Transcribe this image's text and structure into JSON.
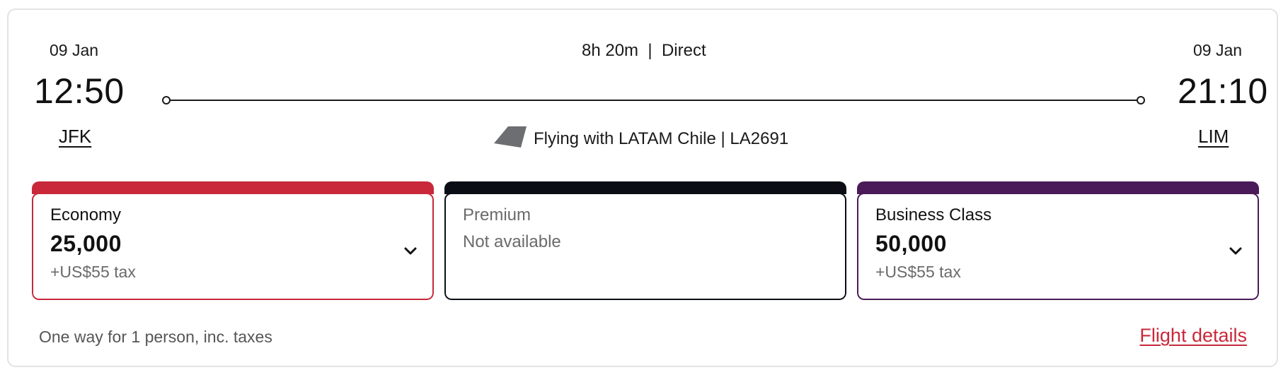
{
  "departure": {
    "date": "09 Jan",
    "time": "12:50",
    "airport": "JFK"
  },
  "arrival": {
    "date": "09 Jan",
    "time": "21:10",
    "airport": "LIM"
  },
  "duration_text": "8h 20m  |  Direct",
  "airline": {
    "text": "Flying with LATAM Chile | LA2691",
    "icon": "latam-tail-icon",
    "icon_color": "#6d6e71"
  },
  "fares": [
    {
      "name": "Economy",
      "price": "25,000",
      "tax": "+US$55 tax",
      "color": "#c8283a"
    },
    {
      "name": "Premium",
      "status": "Not available",
      "color": "#0a0e14"
    },
    {
      "name": "Business Class",
      "price": "50,000",
      "tax": "+US$55 tax",
      "color": "#4b1a58"
    }
  ],
  "footer": {
    "note": "One way for 1 person, inc. taxes",
    "details_link": "Flight details",
    "link_color": "#c8283a"
  }
}
